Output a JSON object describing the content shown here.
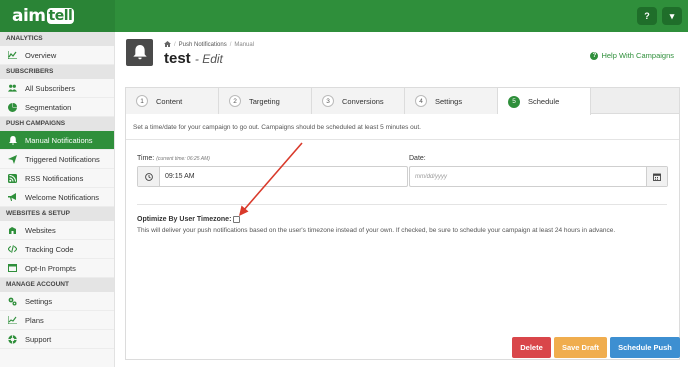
{
  "brand": {
    "logo_prefix": "aim",
    "logo_suffix": "tell"
  },
  "topbar": {
    "help_icon": "question-icon",
    "dropdown_icon": "caret-down-icon"
  },
  "sidebar": {
    "sections": [
      {
        "title": "ANALYTICS",
        "items": [
          {
            "label": "Overview",
            "icon": "chart-icon"
          }
        ]
      },
      {
        "title": "SUBSCRIBERS",
        "items": [
          {
            "label": "All Subscribers",
            "icon": "users-icon"
          },
          {
            "label": "Segmentation",
            "icon": "pie-icon"
          }
        ]
      },
      {
        "title": "PUSH CAMPAIGNS",
        "items": [
          {
            "label": "Manual Notifications",
            "icon": "bell-icon",
            "active": true
          },
          {
            "label": "Triggered Notifications",
            "icon": "send-icon"
          },
          {
            "label": "RSS Notifications",
            "icon": "rss-icon"
          },
          {
            "label": "Welcome Notifications",
            "icon": "bullhorn-icon"
          }
        ]
      },
      {
        "title": "WEBSITES & SETUP",
        "items": [
          {
            "label": "Websites",
            "icon": "globe-icon"
          },
          {
            "label": "Tracking Code",
            "icon": "code-icon"
          },
          {
            "label": "Opt-In Prompts",
            "icon": "window-icon"
          }
        ]
      },
      {
        "title": "MANAGE ACCOUNT",
        "items": [
          {
            "label": "Settings",
            "icon": "gears-icon"
          },
          {
            "label": "Plans",
            "icon": "line-chart-icon"
          },
          {
            "label": "Support",
            "icon": "lifebuoy-icon"
          }
        ]
      }
    ]
  },
  "header": {
    "breadcrumb": {
      "home_icon": "home-icon",
      "parent": "Push Notifications",
      "current": "Manual"
    },
    "title": "test",
    "subtitle": "- Edit",
    "help_link": "Help With Campaigns"
  },
  "tabs": [
    {
      "num": "1",
      "label": "Content"
    },
    {
      "num": "2",
      "label": "Targeting"
    },
    {
      "num": "3",
      "label": "Conversions"
    },
    {
      "num": "4",
      "label": "Settings"
    },
    {
      "num": "5",
      "label": "Schedule",
      "active": true
    }
  ],
  "schedule": {
    "intro": "Set a time/date for your campaign to go out. Campaigns should be scheduled at least 5 minutes out.",
    "time_label": "Time:",
    "time_hint": "(current time: 06:25 AM)",
    "time_value": "09:15 AM",
    "date_label": "Date:",
    "date_placeholder": "mm/dd/yyyy",
    "timezone_label": "Optimize By User Timezone:",
    "timezone_checked": false,
    "timezone_desc": "This will deliver your push notifications based on the user's timezone instead of your own. If checked, be sure to schedule your campaign at least 24 hours in advance."
  },
  "actions": {
    "delete": "Delete",
    "save_draft": "Save Draft",
    "schedule_push": "Schedule Push"
  },
  "colors": {
    "brand_green": "#2f8f3b",
    "delete_red": "#d9464a",
    "draft_orange": "#f0ad4e",
    "push_blue": "#3d8fd1",
    "annotation_arrow": "#d93a2b"
  }
}
